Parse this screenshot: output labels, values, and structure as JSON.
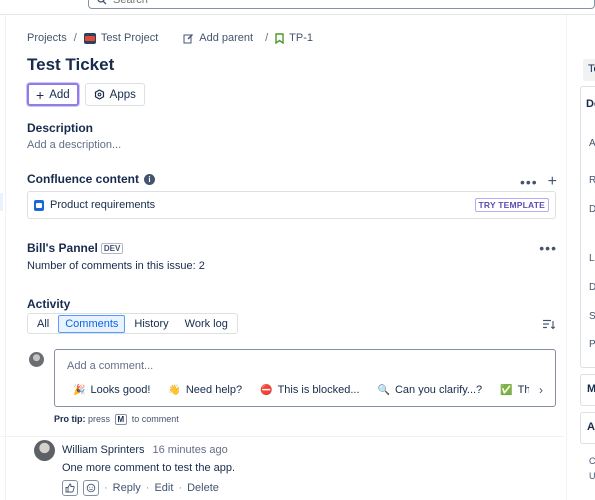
{
  "search": {
    "placeholder": "Search"
  },
  "breadcrumb": {
    "projects": "Projects",
    "project": "Test Project",
    "add_parent": "Add parent",
    "issue_key": "TP-1"
  },
  "issue": {
    "title": "Test Ticket",
    "add_label": "Add",
    "apps_label": "Apps"
  },
  "description": {
    "heading": "Description",
    "placeholder": "Add a description..."
  },
  "confluence": {
    "heading": "Confluence content",
    "item_label": "Product requirements",
    "badge": "TRY TEMPLATE"
  },
  "panel": {
    "heading": "Bill's Pannel",
    "badge": "DEV",
    "text": "Number of comments in this issue: 2"
  },
  "activity": {
    "heading": "Activity",
    "tabs": [
      "All",
      "Comments",
      "History",
      "Work log"
    ],
    "active_tab": "Comments"
  },
  "comment_editor": {
    "placeholder": "Add a comment...",
    "quick_replies": [
      {
        "emoji": "🎉",
        "label": "Looks good!"
      },
      {
        "emoji": "👋",
        "label": "Need help?"
      },
      {
        "emoji": "⛔",
        "label": "This is blocked..."
      },
      {
        "emoji": "🔍",
        "label": "Can you clarify...?"
      },
      {
        "emoji": "✅",
        "label": "This is on"
      }
    ],
    "pro_tip_label": "Pro tip:",
    "pro_tip_press": "press",
    "pro_tip_key": "M",
    "pro_tip_suffix": "to comment"
  },
  "comments": [
    {
      "author": "William Sprinters",
      "time": "16 minutes ago",
      "text": "One more comment to test the app.",
      "reply": "Reply",
      "edit": "Edit",
      "delete": "Delete"
    }
  ],
  "side": {
    "tab_label": "Te",
    "panel_heading": "De",
    "letters": [
      "A",
      "R",
      "D",
      "L",
      "D",
      "S",
      "P"
    ],
    "box1": "M",
    "box2": "Au",
    "footer1": "C",
    "footer2": "U"
  },
  "colors": {
    "accent": "#0c66e4",
    "focus_ring": "#8f7ee7",
    "text": "#172b4d",
    "subtle": "#626f86"
  }
}
